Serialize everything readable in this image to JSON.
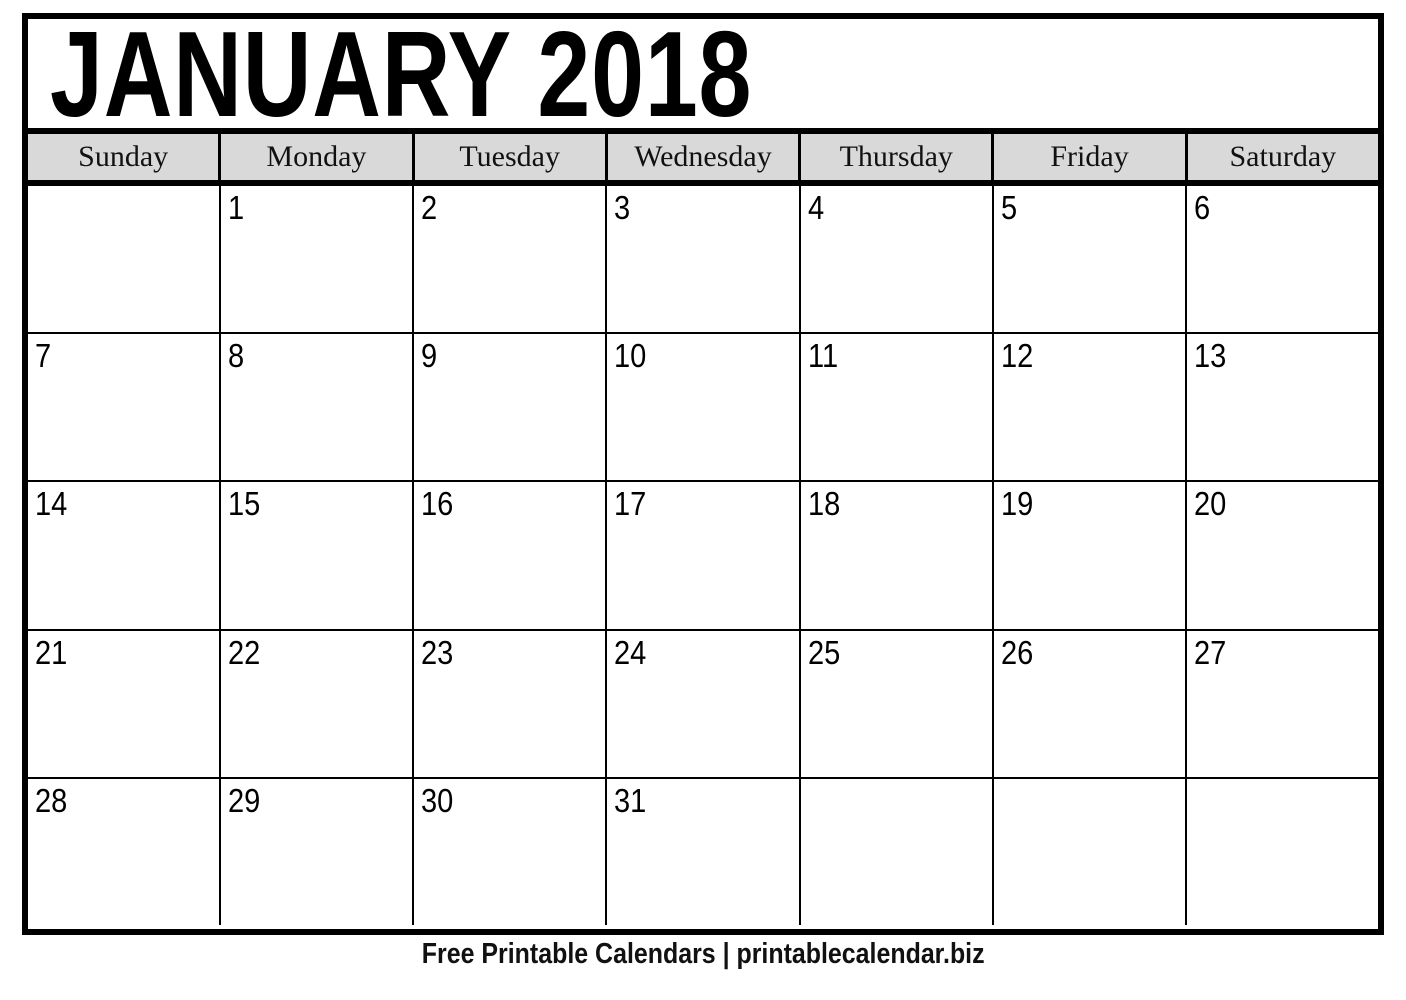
{
  "document": {
    "type": "printable-calendar",
    "month_title": "JANUARY 2018"
  },
  "colors": {
    "frame_border": "#000000",
    "header_background": "#d9d9d9",
    "page_background": "#ffffff",
    "text": "#000000"
  },
  "weekday_headers": [
    "Sunday",
    "Monday",
    "Tuesday",
    "Wednesday",
    "Thursday",
    "Friday",
    "Saturday"
  ],
  "weeks": [
    [
      "",
      "1",
      "2",
      "3",
      "4",
      "5",
      "6"
    ],
    [
      "7",
      "8",
      "9",
      "10",
      "11",
      "12",
      "13"
    ],
    [
      "14",
      "15",
      "16",
      "17",
      "18",
      "19",
      "20"
    ],
    [
      "21",
      "22",
      "23",
      "24",
      "25",
      "26",
      "27"
    ],
    [
      "28",
      "29",
      "30",
      "31",
      "",
      "",
      ""
    ]
  ],
  "footer": {
    "text": "Free Printable Calendars | printablecalendar.biz",
    "label": "Free Printable Calendars",
    "site": "printablecalendar.biz"
  }
}
